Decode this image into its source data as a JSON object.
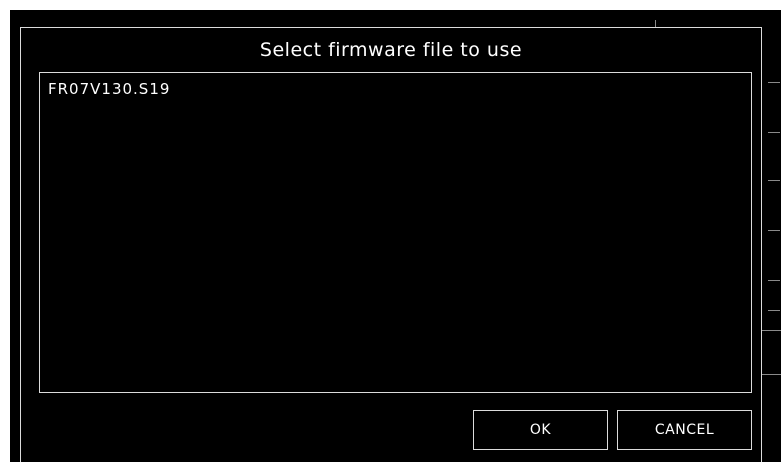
{
  "dialog": {
    "title": "Select firmware file to use",
    "files": [
      {
        "name": "FR07V130.S19"
      }
    ],
    "ok_label": "OK",
    "cancel_label": "CANCEL"
  },
  "colors": {
    "background": "#000000",
    "border": "#dcdcdc",
    "text": "#ffffff",
    "frame": "#ffffff"
  }
}
